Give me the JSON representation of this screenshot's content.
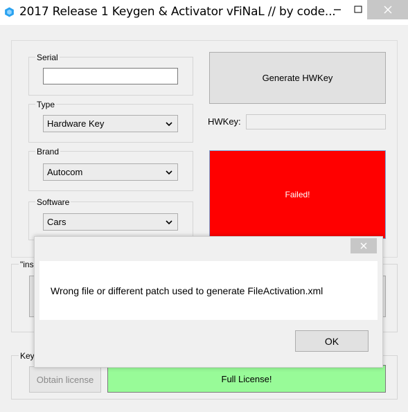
{
  "window": {
    "title": "2017 Release 1 Keygen & Activator vFiNaL // by code...",
    "icon": "app-hex-icon",
    "controls": [
      "minimize-icon",
      "maximize-icon",
      "close-icon"
    ]
  },
  "form": {
    "serial": {
      "label": "Serial",
      "value": ""
    },
    "type": {
      "label": "Type",
      "selected": "Hardware Key"
    },
    "brand": {
      "label": "Brand",
      "selected": "Autocom"
    },
    "software": {
      "label": "Software",
      "selected": "Cars"
    },
    "generate_button": "Generate HWKey",
    "hwkey": {
      "label": "HWKey:",
      "value": ""
    },
    "status": "Failed!",
    "install_group_label": "\"ins",
    "key_group_label": "Key",
    "obtain_license_button": "Obtain license",
    "full_license_button": "Full License!"
  },
  "dialog": {
    "message": "Wrong file or different patch used to generate FileActivation.xml",
    "ok_button": "OK"
  },
  "colors": {
    "failed_bg": "#ff0000",
    "full_license_bg": "#98fb98",
    "window_bg": "#f0f0f0"
  }
}
